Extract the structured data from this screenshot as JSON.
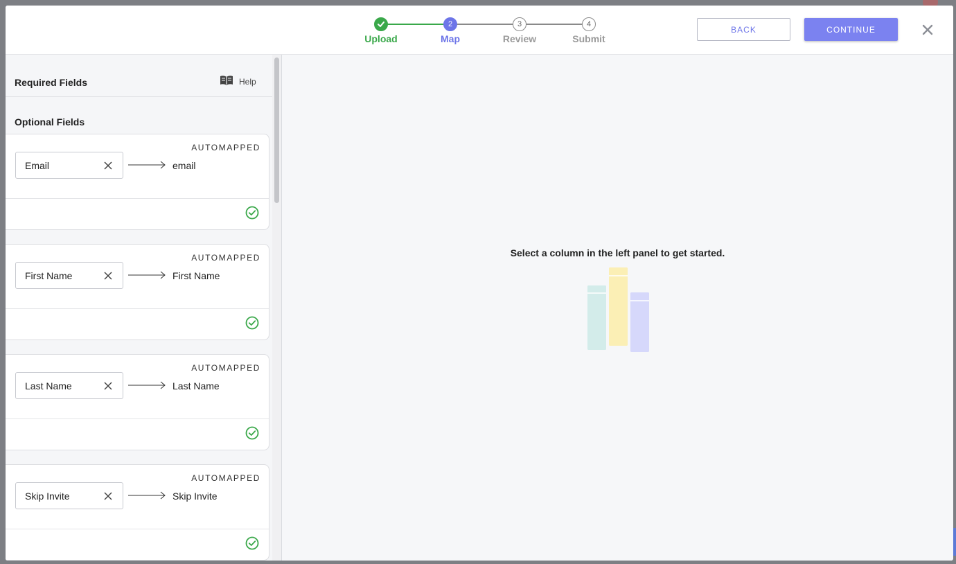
{
  "stepper": {
    "steps": [
      {
        "number": "1",
        "label": "Upload",
        "state": "done"
      },
      {
        "number": "2",
        "label": "Map",
        "state": "active"
      },
      {
        "number": "3",
        "label": "Review",
        "state": "pending"
      },
      {
        "number": "4",
        "label": "Submit",
        "state": "pending"
      }
    ]
  },
  "header": {
    "back_label": "BACK",
    "continue_label": "CONTINUE"
  },
  "left_panel": {
    "required_title": "Required Fields",
    "help_label": "Help",
    "optional_title": "Optional Fields",
    "mappings": [
      {
        "badge": "AUTOMAPPED",
        "column": "Email",
        "target": "email"
      },
      {
        "badge": "AUTOMAPPED",
        "column": "First Name",
        "target": "First Name"
      },
      {
        "badge": "AUTOMAPPED",
        "column": "Last Name",
        "target": "Last Name"
      },
      {
        "badge": "AUTOMAPPED",
        "column": "Skip Invite",
        "target": "Skip Invite"
      }
    ]
  },
  "right_panel": {
    "empty_message": "Select a column in the left panel to get started."
  },
  "colors": {
    "accent": "#6d75e8",
    "success": "#3aa84a"
  }
}
